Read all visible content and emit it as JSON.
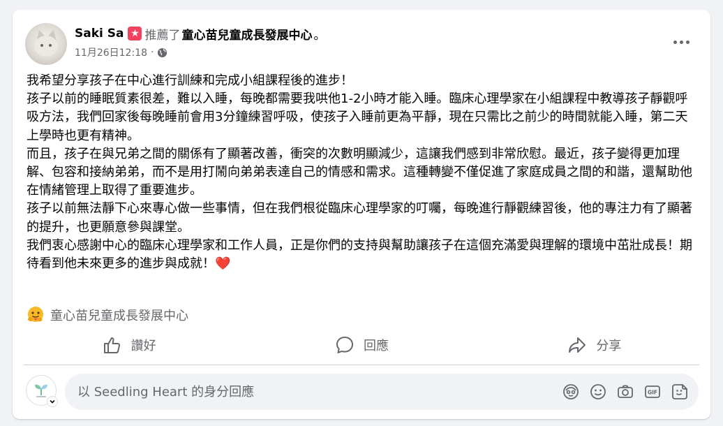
{
  "post": {
    "author": "Saki Sa",
    "recommend_icon": "recommend-star-icon",
    "recommend_text": "推薦了",
    "page_name": "童心苗兒童成長發展中心",
    "period": "。",
    "timestamp": "11月26日12:18",
    "separator": "·",
    "privacy_icon": "globe-icon",
    "body": [
      "我希望分享孩子在中心進行訓練和完成小組課程後的進步！",
      "孩子以前的睡眠質素很差，難以入睡，每晚都需要我哄他1-2小時才能入睡。臨床心理學家在小組課程中教導孩子靜觀呼吸方法，我們回家後每晚睡前會用3分鐘練習呼吸，使孩子入睡前更為平靜，現在只需比之前少的時間就能入睡，第二天上學時也更有精神。",
      "而且，孩子在與兄弟之間的關係有了顯著改善，衝突的次數明顯減少，這讓我們感到非常欣慰。最近，孩子變得更加理解、包容和接納弟弟，而不是用打鬧向弟弟表達自己的情感和需求。這種轉變不僅促進了家庭成員之間的和諧，還幫助他在情緒管理上取得了重要進步。",
      "孩子以前無法靜下心來專心做一些事情，但在我們根從臨床心理學家的叮囑，每晚進行靜觀練習後，他的專注力有了顯著的提升，也更願意參與課堂。",
      "我們衷心感謝中心的臨床心理學家和工作人員，正是你們的支持與幫助讓孩子在這個充滿愛與理解的環境中茁壯成長！期待看到他未來更多的進步與成就！"
    ],
    "ending_emoji": "❤️",
    "tagged_page": "童心苗兒童成長發展中心",
    "tagged_icon": "care-hug-emoji-icon"
  },
  "actions": [
    {
      "label": "讚好",
      "icon": "thumbs-up-icon"
    },
    {
      "label": "回應",
      "icon": "comment-bubble-icon"
    },
    {
      "label": "分享",
      "icon": "share-arrow-icon"
    }
  ],
  "comment": {
    "placeholder": "以 Seedling Heart 的身分回應",
    "icons": [
      "avatar-sticker-icon",
      "emoji-icon",
      "camera-icon",
      "gif-icon",
      "sticker-icon"
    ]
  },
  "colors": {
    "background": "#f0f2f5",
    "secondary_text": "#65676b",
    "recommend_red": "#f3425f",
    "heart_red": "#e41e3f"
  }
}
